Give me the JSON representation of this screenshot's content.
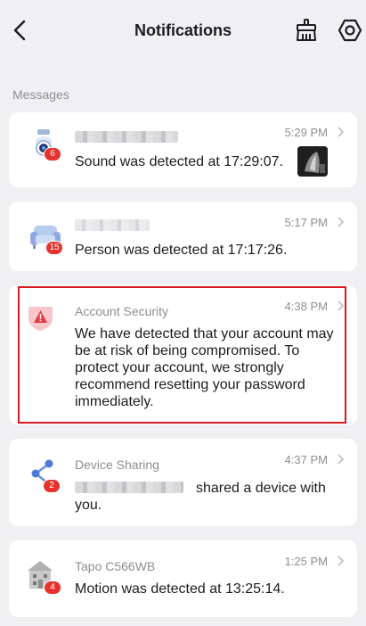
{
  "header": {
    "title": "Notifications",
    "back_icon": "back-arrow-icon",
    "clean_icon": "broom-icon",
    "settings_icon": "settings-gear-icon"
  },
  "section_title": "Messages",
  "colors": {
    "badge": "#e5322d",
    "alert_red": "#d71a20",
    "background": "#f0f0f3"
  },
  "notifications": [
    {
      "icon": "camera-icon",
      "badge": "6",
      "source": "",
      "time": "5:29 PM",
      "message": "Sound was detected at 17:29:07.",
      "has_thumbnail": true
    },
    {
      "icon": "sofa-icon",
      "badge": "15",
      "source": "",
      "time": "5:17 PM",
      "message": "Person was detected at 17:17:26."
    },
    {
      "icon": "warning-shield-icon",
      "source": "Account Security",
      "time": "4:38 PM",
      "message": "We have detected that your account may be at risk of being compromised. To protect your account, we strongly recommend resetting your password immediately."
    },
    {
      "icon": "share-icon",
      "badge": "2",
      "source": "Device Sharing",
      "time": "4:37 PM",
      "message": "shared a device with you."
    },
    {
      "icon": "house-icon",
      "badge": "4",
      "source": "Tapo C566WB",
      "time": "1:25 PM",
      "message": "Motion was detected at 13:25:14."
    }
  ]
}
